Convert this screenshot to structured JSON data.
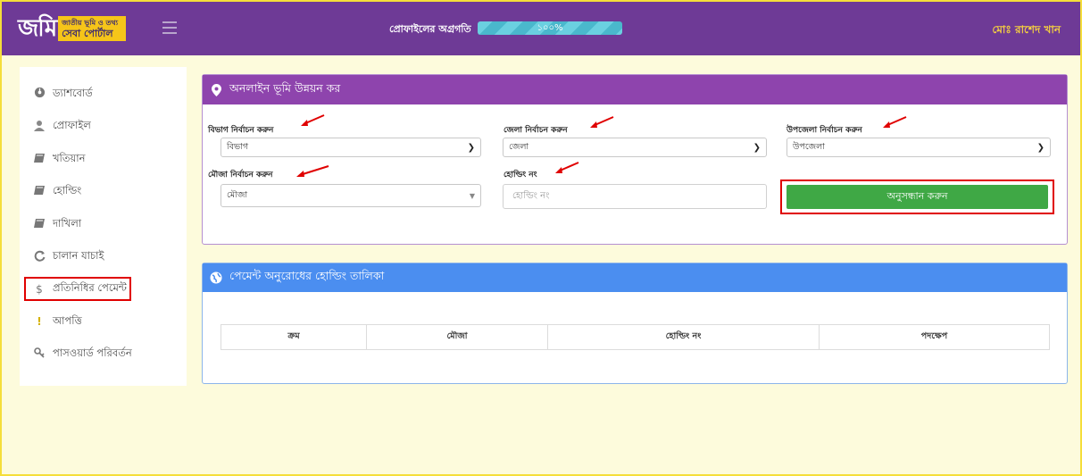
{
  "header": {
    "logo_main": "জমি",
    "logo_tag_top": "জাতীয় ভূমি ও তথ্য",
    "logo_tag_bottom": "সেবা পোর্টাল",
    "progress_label": "প্রোফাইলের অগ্রগতি",
    "progress_value": 1.0,
    "progress_text": "১০০%",
    "user_name": "মোঃ রাশেদ খান",
    "colors": {
      "bar": "#6e3a96",
      "progress": "#4ab8cc",
      "user": "#f5d040"
    }
  },
  "sidebar": {
    "items": [
      {
        "icon": "dashboard-icon",
        "label": "ড্যাশবোর্ড"
      },
      {
        "icon": "user-icon",
        "label": "প্রোফাইল"
      },
      {
        "icon": "book-icon",
        "label": "খতিয়ান"
      },
      {
        "icon": "book-icon",
        "label": "হোল্ডিং"
      },
      {
        "icon": "book-icon",
        "label": "দাখিলা"
      },
      {
        "icon": "refresh-icon",
        "label": "চালান যাচাই"
      },
      {
        "icon": "dollar-icon",
        "label": "প্রতিনিধির পেমেন্ট",
        "highlighted": true
      },
      {
        "icon": "exclamation-icon",
        "label": "আপত্তি"
      },
      {
        "icon": "key-icon",
        "label": "পাসওয়ার্ড পরিবর্তন"
      }
    ]
  },
  "search_panel": {
    "title": "অনলাইন ভূমি উন্নয়ন কর",
    "color": "#8e44ad",
    "division_label": "বিভাগ নির্বাচন করুন",
    "division_value": "বিভাগ",
    "district_label": "জেলা নির্বাচন করুন",
    "district_value": "জেলা",
    "upazila_label": "উপজেলা নির্বাচন করুন",
    "upazila_value": "উপজেলা",
    "mouza_label": "মৌজা নির্বাচন করুন",
    "mouza_value": "মৌজা",
    "holding_label": "হোল্ডিং নং",
    "holding_placeholder": "হোল্ডিং নং",
    "search_button": "অনুসন্ধান করুন",
    "button_color": "#3fa845"
  },
  "holding_panel": {
    "title": "পেমেন্ট অনুরোধের হোল্ডিং তালিকা",
    "color": "#4b8ef0",
    "columns": [
      "ক্রম",
      "মৌজা",
      "হোল্ডিং নং",
      "পদক্ষেপ"
    ]
  }
}
